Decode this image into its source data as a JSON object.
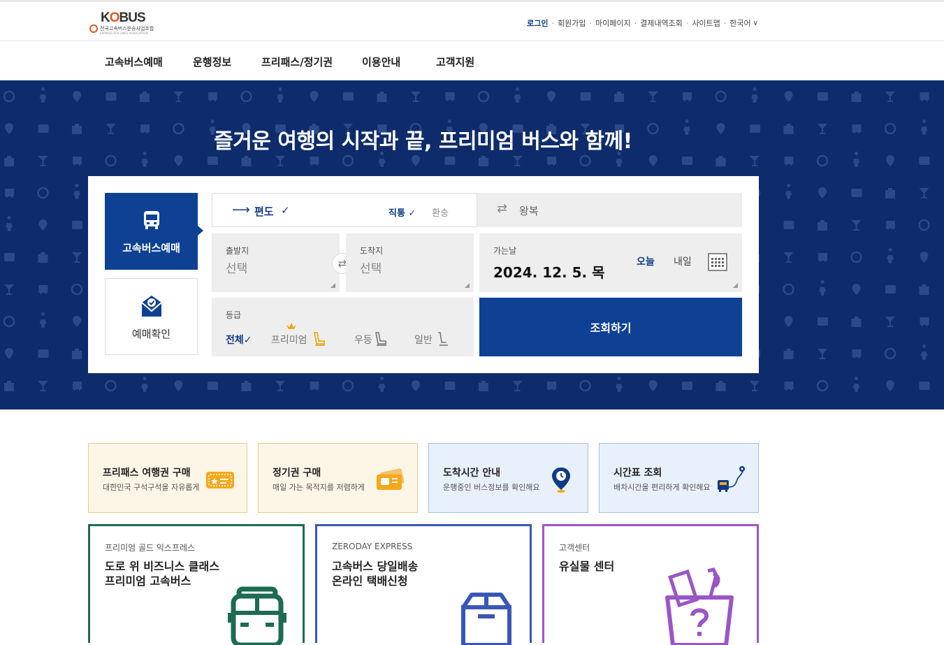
{
  "logo": {
    "brand": "KOBUS",
    "org": "전국고속버스운송사업조합",
    "org_en": "EXPRESS BUS LINES ASSOCIATION"
  },
  "util_menu": [
    {
      "label": "로그인",
      "name": "login-link"
    },
    {
      "label": "회원가입",
      "name": "signup-link"
    },
    {
      "label": "마이페이지",
      "name": "mypage-link"
    },
    {
      "label": "결제내역조회",
      "name": "payment-history-link"
    },
    {
      "label": "사이트맵",
      "name": "sitemap-link"
    },
    {
      "label": "한국어",
      "name": "language-selector"
    }
  ],
  "nav": [
    {
      "label": "고속버스예매",
      "name": "nav-reservation"
    },
    {
      "label": "운행정보",
      "name": "nav-route-info"
    },
    {
      "label": "프리패스/정기권",
      "name": "nav-freepass"
    },
    {
      "label": "이용안내",
      "name": "nav-guide"
    },
    {
      "label": "고객지원",
      "name": "nav-support"
    }
  ],
  "hero": {
    "title": "즐거운 여행의 시작과 끝, 프리미엄 버스와 함께!"
  },
  "booking": {
    "tab_reserve": "고속버스예매",
    "tab_check": "예매확인",
    "oneway": "편도",
    "direct": "직통",
    "transfer": "환승",
    "roundtrip": "왕복",
    "depart_label": "출발지",
    "depart_value": "선택",
    "arrive_label": "도착지",
    "arrive_value": "선택",
    "date_label": "가는날",
    "date_value": "2024. 12. 5. 목",
    "today": "오늘",
    "tomorrow": "내일",
    "grade_label": "등급",
    "grade_all": "전체",
    "grade_premium": "프리미엄",
    "grade_first": "우등",
    "grade_general": "일반",
    "search": "조회하기",
    "check_mark": "✓"
  },
  "cards": [
    {
      "title": "프리패스 여행권 구매",
      "desc": "대한민국 구석구석을 자유롭게",
      "icon": "ticket-icon",
      "bg": "#fdf5e6",
      "border": "#e8c98f"
    },
    {
      "title": "정기권 구매",
      "desc": "매일 가는 목적지를 저렴하게",
      "icon": "pass-icon",
      "bg": "#fdf5e6",
      "border": "#e8c98f"
    },
    {
      "title": "도착시간 안내",
      "desc": "운행중인 버스정보를 확인해요",
      "icon": "location-clock-icon",
      "bg": "#e8f0fb",
      "border": "#a9bfe6"
    },
    {
      "title": "시간표 조회",
      "desc": "배차시간을 편리하게 확인해요",
      "icon": "route-icon",
      "bg": "#e8f0fb",
      "border": "#a9bfe6"
    }
  ],
  "banners": [
    {
      "kicker": "프리미엄 골드 익스프레스",
      "title": "도로 위 비즈니스 클래스\n프리미엄 고속버스",
      "color": "#1d6b52",
      "icon": "bus-icon"
    },
    {
      "kicker": "ZERODAY EXPRESS",
      "title": "고속버스 당일배송\n온라인 택배신청",
      "color": "#3a57b6",
      "icon": "parcel-box-icon"
    },
    {
      "kicker": "고객센터",
      "title": "유실물 센터",
      "color": "#9a55c6",
      "icon": "lost-found-box-icon"
    }
  ]
}
